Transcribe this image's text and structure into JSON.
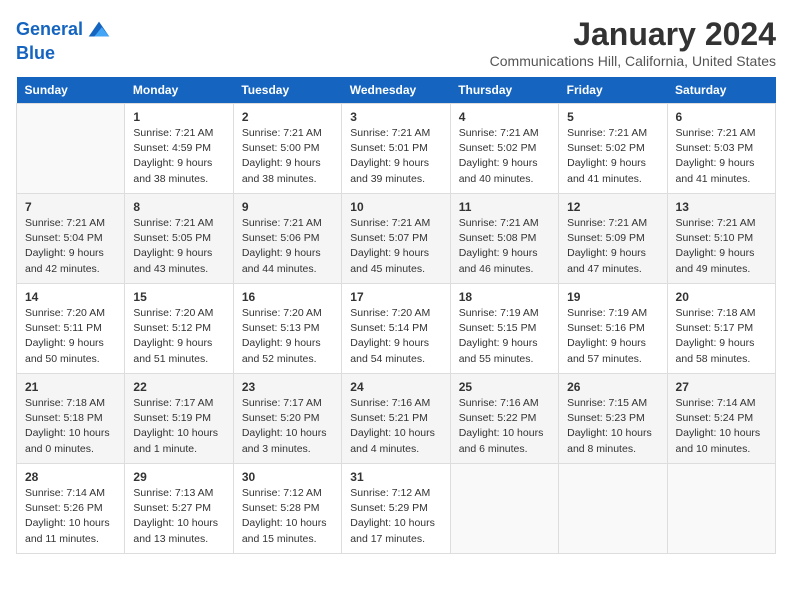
{
  "logo": {
    "line1": "General",
    "line2": "Blue"
  },
  "title": "January 2024",
  "subtitle": "Communications Hill, California, United States",
  "headers": [
    "Sunday",
    "Monday",
    "Tuesday",
    "Wednesday",
    "Thursday",
    "Friday",
    "Saturday"
  ],
  "weeks": [
    [
      {
        "day": "",
        "info": ""
      },
      {
        "day": "1",
        "info": "Sunrise: 7:21 AM\nSunset: 4:59 PM\nDaylight: 9 hours\nand 38 minutes."
      },
      {
        "day": "2",
        "info": "Sunrise: 7:21 AM\nSunset: 5:00 PM\nDaylight: 9 hours\nand 38 minutes."
      },
      {
        "day": "3",
        "info": "Sunrise: 7:21 AM\nSunset: 5:01 PM\nDaylight: 9 hours\nand 39 minutes."
      },
      {
        "day": "4",
        "info": "Sunrise: 7:21 AM\nSunset: 5:02 PM\nDaylight: 9 hours\nand 40 minutes."
      },
      {
        "day": "5",
        "info": "Sunrise: 7:21 AM\nSunset: 5:02 PM\nDaylight: 9 hours\nand 41 minutes."
      },
      {
        "day": "6",
        "info": "Sunrise: 7:21 AM\nSunset: 5:03 PM\nDaylight: 9 hours\nand 41 minutes."
      }
    ],
    [
      {
        "day": "7",
        "info": "Sunrise: 7:21 AM\nSunset: 5:04 PM\nDaylight: 9 hours\nand 42 minutes."
      },
      {
        "day": "8",
        "info": "Sunrise: 7:21 AM\nSunset: 5:05 PM\nDaylight: 9 hours\nand 43 minutes."
      },
      {
        "day": "9",
        "info": "Sunrise: 7:21 AM\nSunset: 5:06 PM\nDaylight: 9 hours\nand 44 minutes."
      },
      {
        "day": "10",
        "info": "Sunrise: 7:21 AM\nSunset: 5:07 PM\nDaylight: 9 hours\nand 45 minutes."
      },
      {
        "day": "11",
        "info": "Sunrise: 7:21 AM\nSunset: 5:08 PM\nDaylight: 9 hours\nand 46 minutes."
      },
      {
        "day": "12",
        "info": "Sunrise: 7:21 AM\nSunset: 5:09 PM\nDaylight: 9 hours\nand 47 minutes."
      },
      {
        "day": "13",
        "info": "Sunrise: 7:21 AM\nSunset: 5:10 PM\nDaylight: 9 hours\nand 49 minutes."
      }
    ],
    [
      {
        "day": "14",
        "info": "Sunrise: 7:20 AM\nSunset: 5:11 PM\nDaylight: 9 hours\nand 50 minutes."
      },
      {
        "day": "15",
        "info": "Sunrise: 7:20 AM\nSunset: 5:12 PM\nDaylight: 9 hours\nand 51 minutes."
      },
      {
        "day": "16",
        "info": "Sunrise: 7:20 AM\nSunset: 5:13 PM\nDaylight: 9 hours\nand 52 minutes."
      },
      {
        "day": "17",
        "info": "Sunrise: 7:20 AM\nSunset: 5:14 PM\nDaylight: 9 hours\nand 54 minutes."
      },
      {
        "day": "18",
        "info": "Sunrise: 7:19 AM\nSunset: 5:15 PM\nDaylight: 9 hours\nand 55 minutes."
      },
      {
        "day": "19",
        "info": "Sunrise: 7:19 AM\nSunset: 5:16 PM\nDaylight: 9 hours\nand 57 minutes."
      },
      {
        "day": "20",
        "info": "Sunrise: 7:18 AM\nSunset: 5:17 PM\nDaylight: 9 hours\nand 58 minutes."
      }
    ],
    [
      {
        "day": "21",
        "info": "Sunrise: 7:18 AM\nSunset: 5:18 PM\nDaylight: 10 hours\nand 0 minutes."
      },
      {
        "day": "22",
        "info": "Sunrise: 7:17 AM\nSunset: 5:19 PM\nDaylight: 10 hours\nand 1 minute."
      },
      {
        "day": "23",
        "info": "Sunrise: 7:17 AM\nSunset: 5:20 PM\nDaylight: 10 hours\nand 3 minutes."
      },
      {
        "day": "24",
        "info": "Sunrise: 7:16 AM\nSunset: 5:21 PM\nDaylight: 10 hours\nand 4 minutes."
      },
      {
        "day": "25",
        "info": "Sunrise: 7:16 AM\nSunset: 5:22 PM\nDaylight: 10 hours\nand 6 minutes."
      },
      {
        "day": "26",
        "info": "Sunrise: 7:15 AM\nSunset: 5:23 PM\nDaylight: 10 hours\nand 8 minutes."
      },
      {
        "day": "27",
        "info": "Sunrise: 7:14 AM\nSunset: 5:24 PM\nDaylight: 10 hours\nand 10 minutes."
      }
    ],
    [
      {
        "day": "28",
        "info": "Sunrise: 7:14 AM\nSunset: 5:26 PM\nDaylight: 10 hours\nand 11 minutes."
      },
      {
        "day": "29",
        "info": "Sunrise: 7:13 AM\nSunset: 5:27 PM\nDaylight: 10 hours\nand 13 minutes."
      },
      {
        "day": "30",
        "info": "Sunrise: 7:12 AM\nSunset: 5:28 PM\nDaylight: 10 hours\nand 15 minutes."
      },
      {
        "day": "31",
        "info": "Sunrise: 7:12 AM\nSunset: 5:29 PM\nDaylight: 10 hours\nand 17 minutes."
      },
      {
        "day": "",
        "info": ""
      },
      {
        "day": "",
        "info": ""
      },
      {
        "day": "",
        "info": ""
      }
    ]
  ]
}
